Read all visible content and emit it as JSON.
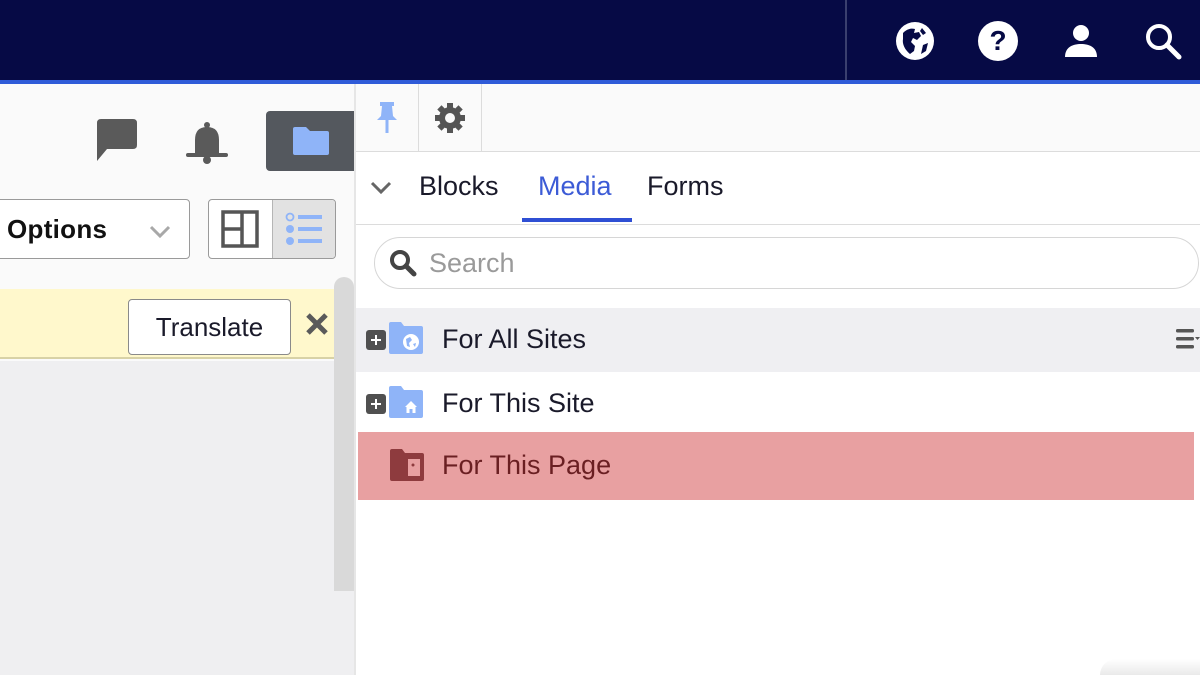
{
  "topbar": {
    "icons": [
      {
        "name": "globe-icon",
        "label": "Language"
      },
      {
        "name": "help-icon",
        "label": "Help"
      },
      {
        "name": "user-icon",
        "label": "Account"
      },
      {
        "name": "search-icon",
        "label": "Search"
      }
    ],
    "colors": {
      "background": "#060a45",
      "accent": "#2f5bd8"
    }
  },
  "left_pane": {
    "toolbar_icons": [
      "chat-icon",
      "bell-icon",
      "folder-icon"
    ],
    "options_select": {
      "value": "Options"
    },
    "view_toggle": {
      "options": [
        "grid-layout",
        "list-layout"
      ],
      "active": "list-layout"
    },
    "translate_bar": {
      "button_label": "Translate",
      "close_label": "✕"
    }
  },
  "right_pane": {
    "toolbar": {
      "pin_active": true,
      "buttons": [
        "pin-icon",
        "gear-icon"
      ]
    },
    "tabs": [
      {
        "label": "Blocks",
        "active": false
      },
      {
        "label": "Media",
        "active": true
      },
      {
        "label": "Forms",
        "active": false
      }
    ],
    "search": {
      "placeholder": "Search",
      "value": ""
    },
    "tree": [
      {
        "label": "For All Sites",
        "icon": "globe-folder-icon",
        "expandable": true,
        "hovered": true
      },
      {
        "label": "For This Site",
        "icon": "home-folder-icon",
        "expandable": true,
        "hovered": false
      },
      {
        "label": "For This Page",
        "icon": "page-folder-icon",
        "expandable": false,
        "highlighted": true
      }
    ],
    "colors": {
      "active_tab": "#3c5bd6",
      "highlight_row": "#e8a0a1",
      "folder_blue": "#8fb4f8"
    }
  }
}
